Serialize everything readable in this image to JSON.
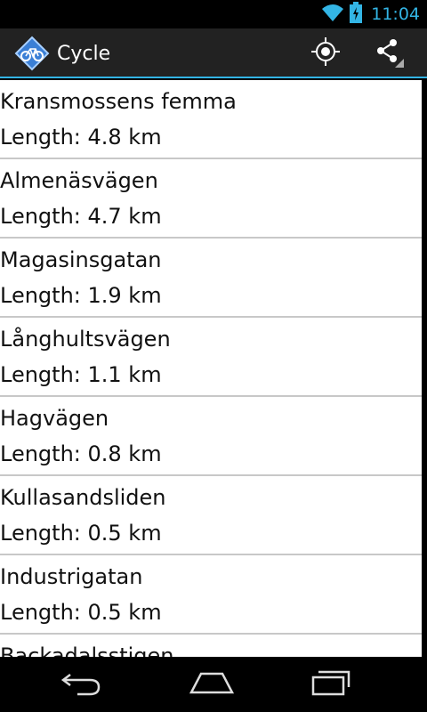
{
  "status": {
    "time": "11:04"
  },
  "app": {
    "title": "Cycle"
  },
  "routes": [
    {
      "name": "Kransmossens femma",
      "length": "Length: 4.8 km"
    },
    {
      "name": "Almenäsvägen",
      "length": "Length: 4.7 km"
    },
    {
      "name": "Magasinsgatan",
      "length": "Length: 1.9 km"
    },
    {
      "name": "Långhultsvägen",
      "length": "Length: 1.1 km"
    },
    {
      "name": "Hagvägen",
      "length": "Length: 0.8 km"
    },
    {
      "name": "Kullasandsliden",
      "length": "Length: 0.5 km"
    },
    {
      "name": "Industrigatan",
      "length": "Length: 0.5 km"
    },
    {
      "name": "Backadalsstigen",
      "length": ""
    }
  ],
  "icons": {
    "wifi": "wifi-icon",
    "battery": "battery-charging-icon",
    "logo": "bicycle-logo-icon",
    "locate": "my-location-icon",
    "share": "share-icon",
    "back": "back-icon",
    "home": "home-icon",
    "recent": "recent-apps-icon"
  },
  "colors": {
    "accent": "#33b5e5",
    "action_bar": "#222222",
    "list_bg": "#ffffff",
    "divider": "#c8c8c8"
  }
}
